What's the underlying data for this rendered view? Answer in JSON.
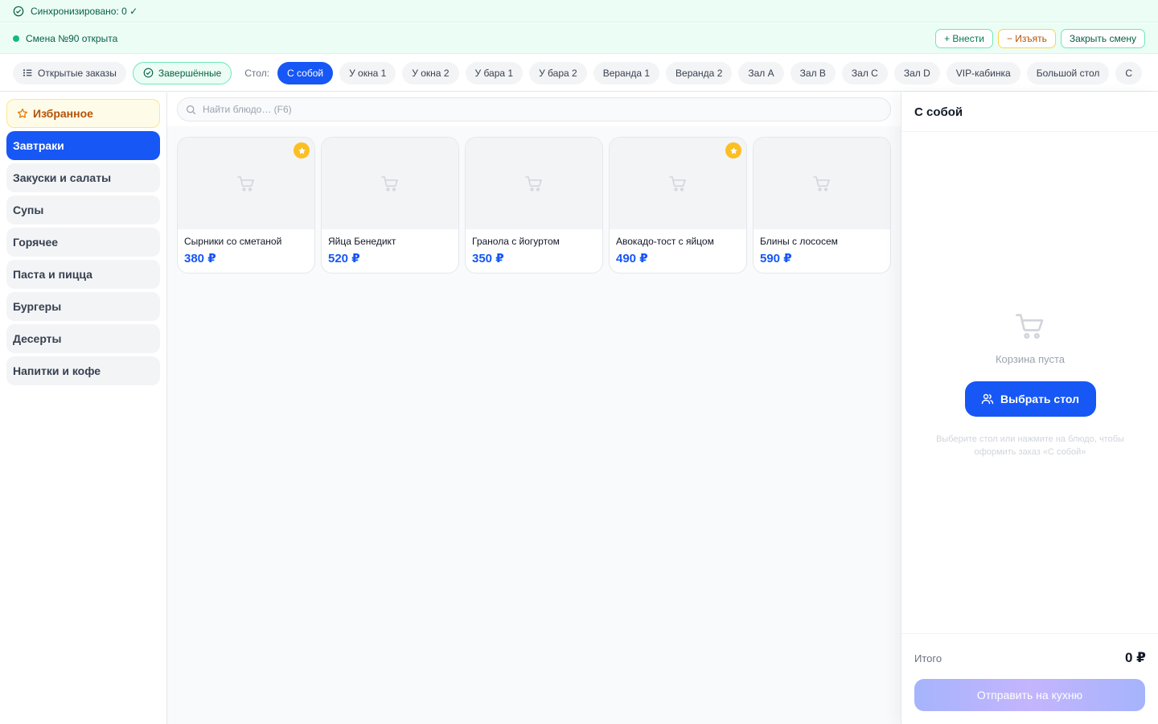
{
  "sync": {
    "text": "Синхронизировано: 0 ✓"
  },
  "shift": {
    "text": "Смена №90 открыта",
    "deposit_label": "+ Внести",
    "withdraw_label": "− Изъять",
    "close_label": "Закрыть смену"
  },
  "filters": {
    "open_orders_label": "Открытые заказы",
    "completed_label": "Завершённые"
  },
  "tables": {
    "label": "Стол:",
    "items": [
      "С собой",
      "У окна 1",
      "У окна 2",
      "У бара 1",
      "У бара 2",
      "Веранда 1",
      "Веранда 2",
      "Зал A",
      "Зал B",
      "Зал C",
      "Зал D",
      "VIP-кабинка",
      "Большой стол",
      "С"
    ],
    "active": "С собой"
  },
  "categories": {
    "favorites": "Избранное",
    "items": [
      "Завтраки",
      "Закуски и салаты",
      "Супы",
      "Горячее",
      "Паста и пицца",
      "Бургеры",
      "Десерты",
      "Напитки и кофе"
    ],
    "active": "Завтраки"
  },
  "search": {
    "placeholder": "Найти блюдо… (F6)"
  },
  "products": [
    {
      "name": "Сырники со сметаной",
      "price": "380 ₽",
      "favorite": true
    },
    {
      "name": "Яйца Бенедикт",
      "price": "520 ₽",
      "favorite": false
    },
    {
      "name": "Гранола с йогуртом",
      "price": "350 ₽",
      "favorite": false
    },
    {
      "name": "Авокадо-тост с яйцом",
      "price": "490 ₽",
      "favorite": true
    },
    {
      "name": "Блины с лососем",
      "price": "590 ₽",
      "favorite": false
    }
  ],
  "cart": {
    "title": "С собой",
    "empty_text": "Корзина пуста",
    "pick_table_label": "Выбрать стол",
    "hint": "Выберите стол или нажмите на блюдо, чтобы оформить заказ «С собой»",
    "total_label": "Итого",
    "total_value": "0 ₽",
    "send_label": "Отправить на кухню"
  },
  "colors": {
    "accent": "#1657f5",
    "success": "#10b981",
    "warning": "#b45309",
    "favorite": "#fbbf24"
  },
  "icons": {
    "sync": "check-circle-icon",
    "shift": "status-dot-icon",
    "open_orders": "list-icon",
    "completed": "check-circle-icon",
    "favorites": "star-icon",
    "search": "search-icon",
    "product_placeholder": "cart-icon",
    "favorite_badge": "star-icon",
    "pick_table": "users-icon"
  }
}
